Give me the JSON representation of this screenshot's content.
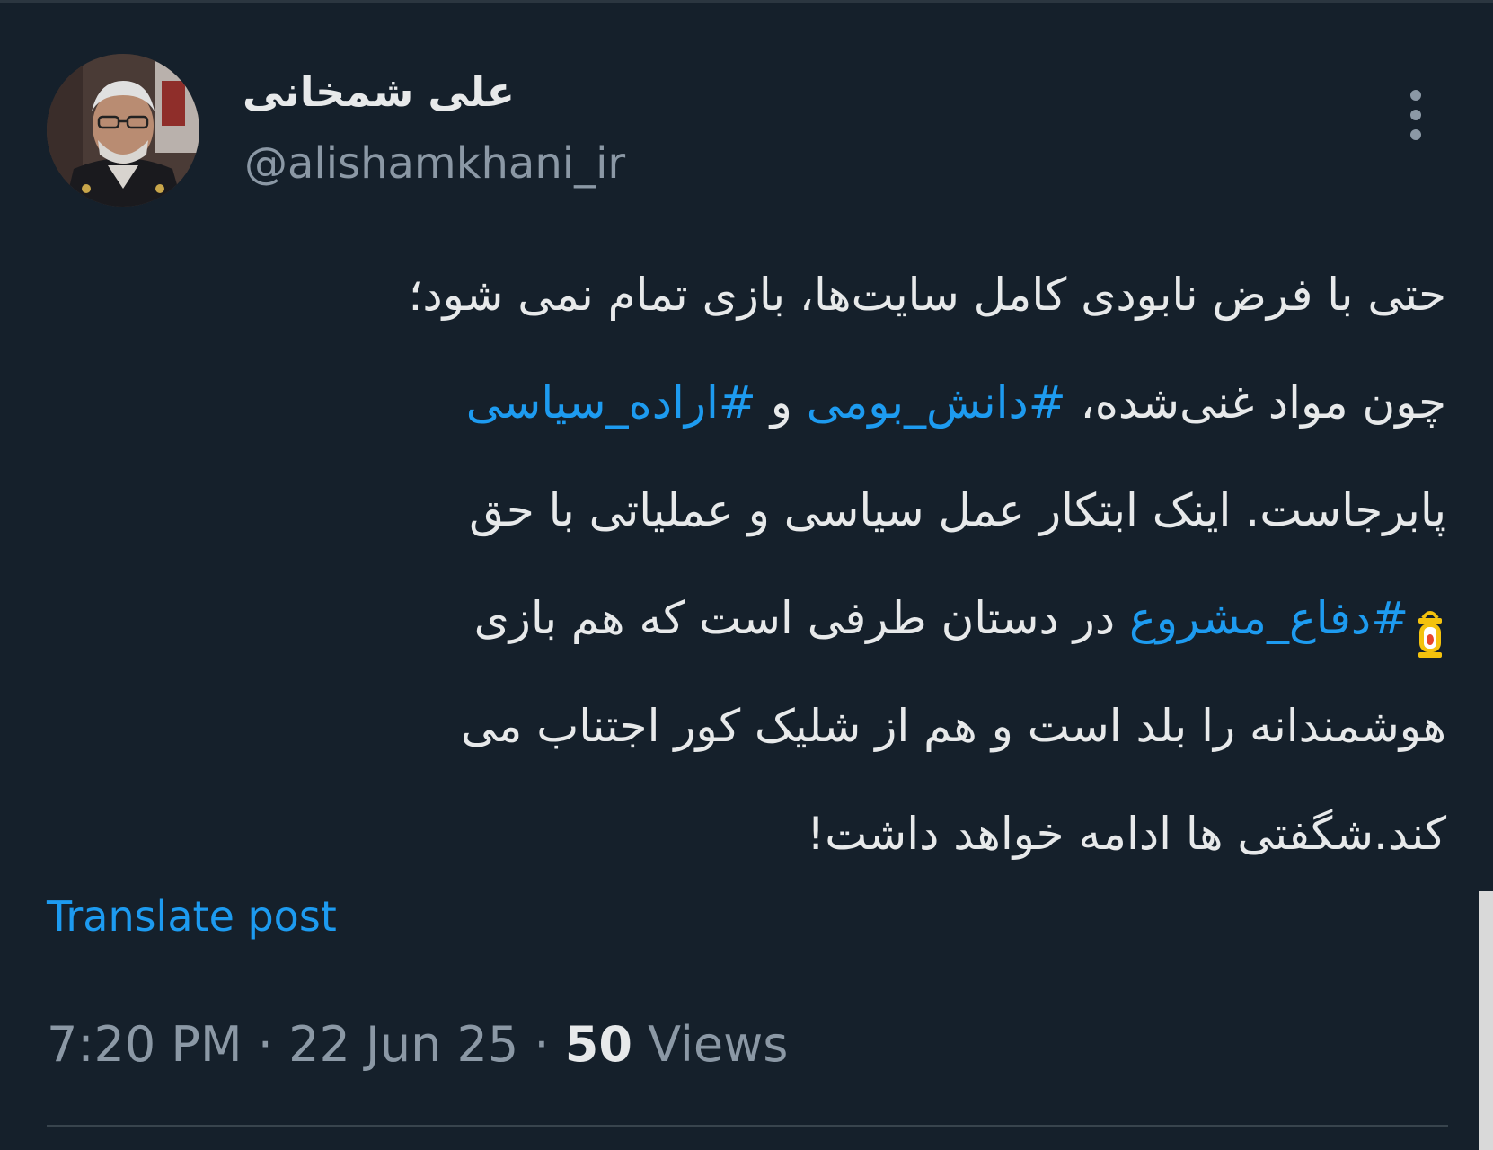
{
  "author": {
    "display_name": "علی شمخانی",
    "handle": "@alishamkhani_ir"
  },
  "tweet": {
    "lines": [
      {
        "parts": [
          {
            "text": "حتی با فرض نابودی کامل سایت‌ها، بازی تمام نمی شود؛"
          }
        ]
      },
      {
        "parts": [
          {
            "text": "چون مواد غنی‌شده، "
          },
          {
            "hashtag": "#دانش_بومی"
          },
          {
            "text": " و "
          },
          {
            "hashtag": "#اراده_سیاسی"
          }
        ]
      },
      {
        "parts": [
          {
            "text": "پابرجاست. اینک ابتکار عمل سیاسی و عملیاتی با حق"
          }
        ]
      },
      {
        "parts": [
          {
            "hashtag": "#دفاع_مشروع"
          },
          {
            "text": " در دستان طرفی است که هم بازی"
          }
        ]
      },
      {
        "parts": [
          {
            "text": "هوشمندانه را بلد است و هم از شلیک کور اجتناب می"
          }
        ]
      },
      {
        "parts": [
          {
            "text": "کند.شگفتی ها ادامه خواهد داشت!"
          }
        ]
      }
    ],
    "emoji": "lantern-emoji"
  },
  "translate_label": "Translate post",
  "meta": {
    "time": "7:20 PM",
    "separator": "·",
    "date": "22 Jun 25",
    "views_count": "50",
    "views_label": "Views"
  },
  "icons": {
    "more": "more-options-icon",
    "lantern": "lantern-emoji"
  },
  "colors": {
    "background": "#15202b",
    "text": "#e7e9ea",
    "secondary": "#8b98a5",
    "link": "#1d9bf0"
  }
}
